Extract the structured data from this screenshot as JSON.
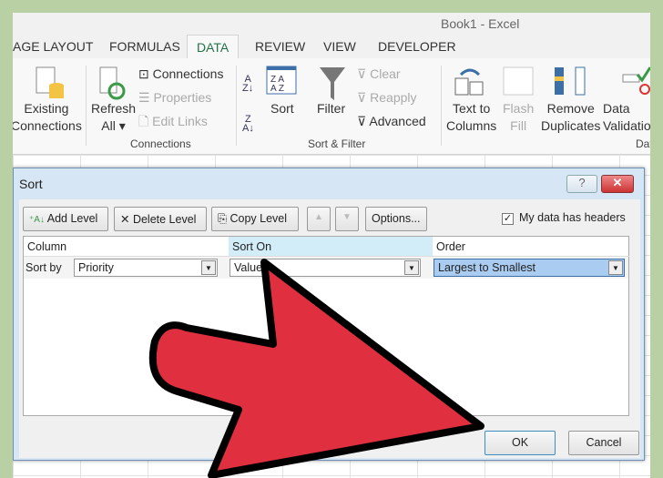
{
  "window": {
    "title": "Book1 - Excel"
  },
  "tabs": [
    {
      "label": "AGE LAYOUT"
    },
    {
      "label": "FORMULAS"
    },
    {
      "label": "DATA",
      "active": true
    },
    {
      "label": "REVIEW"
    },
    {
      "label": "VIEW"
    },
    {
      "label": "DEVELOPER"
    }
  ],
  "ribbon": {
    "existing_connections": "Existing\nConnections",
    "refresh_all": "Refresh\nAll ▾",
    "connections": "Connections",
    "properties": "Properties",
    "edit_links": "Edit Links",
    "group_connections": "Connections",
    "sort": "Sort",
    "filter": "Filter",
    "clear": "Clear",
    "reapply": "Reapply",
    "advanced": "Advanced",
    "group_sort_filter": "Sort & Filter",
    "text_to_columns": "Text to\nColumns",
    "flash_fill": "Flash\nFill",
    "remove_duplicates": "Remove\nDuplicates",
    "data_validation": "Data\nValidation",
    "group_data": "Dat"
  },
  "dialog": {
    "title": "Sort",
    "help": "?",
    "close": "✕",
    "add_level": "Add Level",
    "delete_level": "Delete Level",
    "copy_level": "Copy Level",
    "options": "Options...",
    "headers_checkbox": "My data has headers",
    "headers_checked": true,
    "columns": [
      "Column",
      "Sort On",
      "Order"
    ],
    "row": {
      "label": "Sort by",
      "column": "Priority",
      "sort_on": "Values",
      "order": "Largest to Smallest"
    },
    "ok": "OK",
    "cancel": "Cancel"
  },
  "colors": {
    "accent": "#217346",
    "arrow": "#e03040",
    "dialog_bg": "#d7e6f4"
  }
}
